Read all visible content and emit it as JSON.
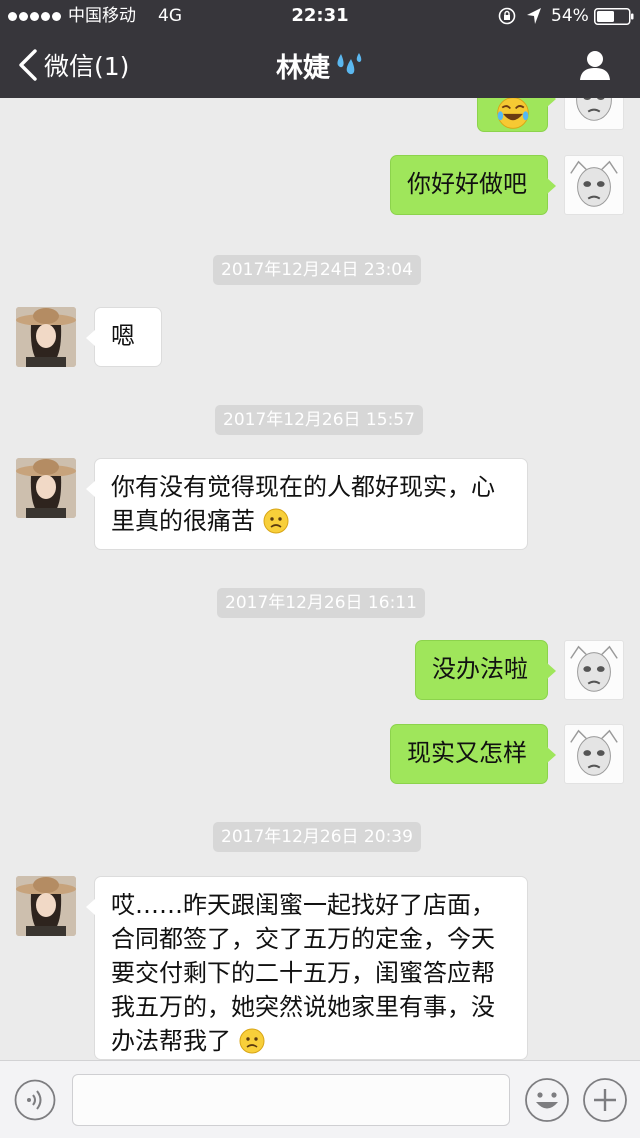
{
  "status_bar": {
    "carrier": "中国移动",
    "network": "4G",
    "time": "22:31",
    "battery": "54%"
  },
  "nav": {
    "back_label": "微信(1)",
    "title": "林婕",
    "title_icon": "sweat-droplets-icon",
    "right_icon": "person-icon"
  },
  "messages": [
    {
      "from": "self",
      "text": "",
      "content_icon": "laughing-tears-emoji"
    },
    {
      "from": "self",
      "text": "你好好做吧"
    },
    {
      "type": "time",
      "text": "2017年12月24日 23:04"
    },
    {
      "from": "friend",
      "text": "嗯"
    },
    {
      "type": "time",
      "text": "2017年12月26日 15:57"
    },
    {
      "from": "friend",
      "line1": "你有没有觉得现在的人都好现实，心",
      "line2": "里真的很痛苦",
      "emoji": "frown-emoji"
    },
    {
      "type": "time",
      "text": "2017年12月26日 16:11"
    },
    {
      "from": "self",
      "text": "没办法啦"
    },
    {
      "from": "self",
      "text": "现实又怎样"
    },
    {
      "type": "time",
      "text": "2017年12月26日 20:39"
    },
    {
      "from": "friend",
      "line1": "哎……昨天跟闺蜜一起找好了店面，",
      "line2": "合同都签了，交了五万的定金，今天",
      "line3": "要交付剩下的二十五万，闺蜜答应帮",
      "line4": "我五万的，她突然说她家里有事，没",
      "line5": "办法帮我了",
      "emoji": "frown-emoji"
    }
  ],
  "input_bar": {
    "placeholder": "",
    "left_icon": "voice-icon",
    "sticker_icon": "smiley-icon",
    "more_icon": "plus-icon"
  },
  "colors": {
    "header": "#37363b",
    "chat_background": "#ebebeb",
    "self_bubble": "#9fe65b",
    "friend_bubble": "#ffffff",
    "timestamp_background": "#d7d7d7"
  }
}
